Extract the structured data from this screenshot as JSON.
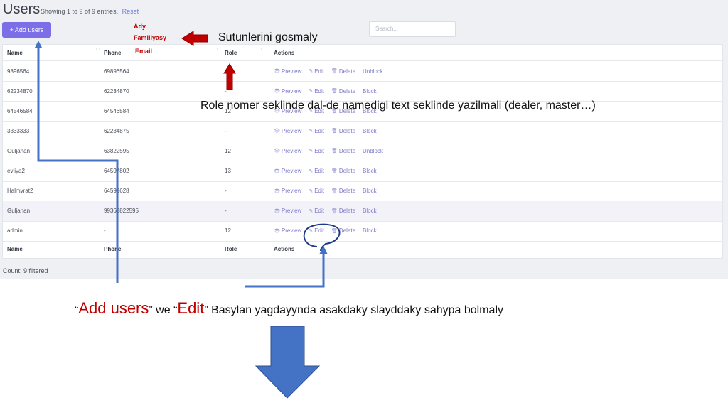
{
  "header": {
    "title": "Users",
    "showing_text": "Showing 1 to 9 of 9 entries.",
    "reset_label": "Reset"
  },
  "toolbar": {
    "add_users_label": "+ Add users",
    "search_placeholder": "Search..."
  },
  "table": {
    "columns": [
      "Name",
      "Phone",
      "Role",
      "Actions"
    ],
    "action_labels": {
      "preview": "Preview",
      "edit": "Edit",
      "delete": "Delete"
    },
    "rows": [
      {
        "name": "9896564",
        "phone": "69896564",
        "role": "",
        "status_action": "Unblock"
      },
      {
        "name": "62234870",
        "phone": "62234870",
        "role": "-",
        "status_action": "Block"
      },
      {
        "name": "64546584",
        "phone": "64546584",
        "role": "12",
        "status_action": "Block"
      },
      {
        "name": "3333333",
        "phone": "62234875",
        "role": "-",
        "status_action": "Block"
      },
      {
        "name": "Guljahan",
        "phone": "63822595",
        "role": "12",
        "status_action": "Unblock"
      },
      {
        "name": "evliya2",
        "phone": "64597802",
        "role": "13",
        "status_action": "Block"
      },
      {
        "name": "Halmyrat2",
        "phone": "64599628",
        "role": "-",
        "status_action": "Block"
      },
      {
        "name": "Guljahan",
        "phone": "99363822595",
        "role": "-",
        "status_action": "Block"
      },
      {
        "name": "admin",
        "phone": "-",
        "role": "12",
        "status_action": "Block"
      }
    ]
  },
  "footer": {
    "count_text": "Count: 9 filtered"
  },
  "annotations": {
    "column_names": [
      "Ady",
      "Familiyasy",
      "Email"
    ],
    "add_columns_note": "Sutunlerini gosmaly",
    "role_note": "Role nomer seklinde dal-de namedigi text seklinde yazilmali (dealer, master…)",
    "bottom_note": {
      "q1_open": "“",
      "add_users": "Add users",
      "q1_close": "”",
      "we": " we ",
      "q2_open": "“",
      "edit": "Edit",
      "q2_close": "”",
      "rest": " Basylan yagdayynda asakdaky slayddaky sahypa  bolmaly"
    }
  },
  "colors": {
    "accent": "#7c6ee6",
    "annotation_red": "#c00000",
    "annotation_blue": "#4472c4"
  }
}
